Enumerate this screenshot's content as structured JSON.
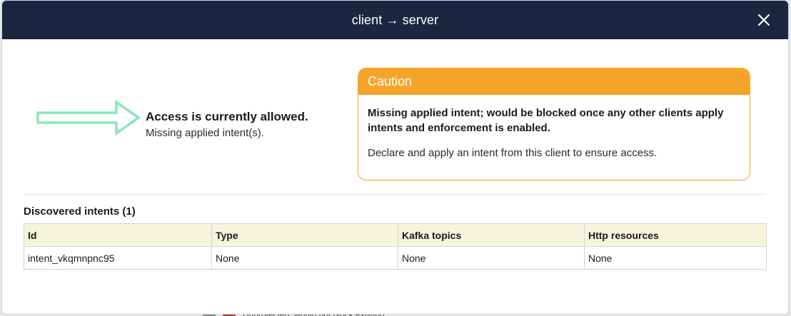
{
  "modal": {
    "title": "client → server",
    "close_icon": "close-icon"
  },
  "status": {
    "icon": "arrow-right-icon",
    "headline": "Access is currently allowed.",
    "detail": "Missing applied intent(s)."
  },
  "caution": {
    "title": "Caution",
    "message_strong": "Missing applied intent; would be blocked once any other clients apply intents and enforcement is enabled.",
    "message": "Declare and apply an intent from this client to ensure access."
  },
  "discovered": {
    "title": "Discovered intents (1)",
    "columns": [
      "Id",
      "Type",
      "Kafka topics",
      "Http resources"
    ],
    "rows": [
      [
        "intent_vkqmnpnc95",
        "None",
        "None",
        "None"
      ]
    ]
  },
  "background": {
    "text": "Unprotected: would not block existing"
  },
  "colors": {
    "header_bg": "#1b2740",
    "caution_accent": "#f5a42a",
    "arrow_green": "#4fd89a",
    "table_header_bg": "#f5f5dc"
  }
}
